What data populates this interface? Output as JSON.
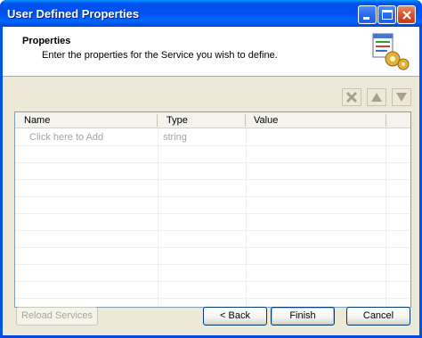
{
  "window": {
    "title": "User Defined Properties"
  },
  "header": {
    "title": "Properties",
    "description": "Enter the properties for the Service you wish to define.",
    "icon": "properties-gear-icon"
  },
  "toolbar": {
    "delete_icon": "delete-x-icon",
    "up_icon": "arrow-up-icon",
    "down_icon": "arrow-down-icon"
  },
  "grid": {
    "columns": [
      "Name",
      "Type",
      "Value"
    ],
    "rows": [
      {
        "name": "Click here to Add",
        "type": "string",
        "value": ""
      }
    ]
  },
  "buttons": {
    "reload": "Reload Services",
    "back": "< Back",
    "finish": "Finish",
    "cancel": "Cancel"
  },
  "colors": {
    "titlebar": "#0054e3",
    "client": "#ece9d8",
    "placeholder_text": "#a5a5a5"
  }
}
